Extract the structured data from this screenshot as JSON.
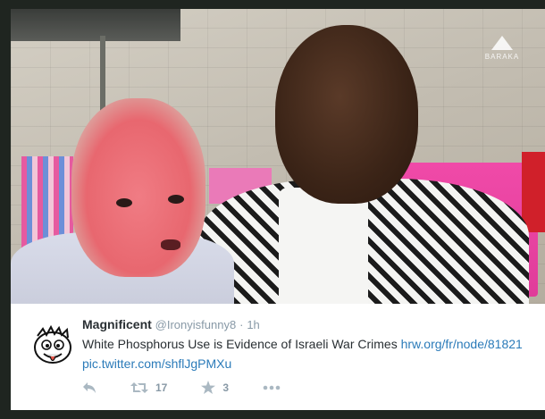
{
  "photo": {
    "watermark": "BARAKA"
  },
  "tweet": {
    "display_name": "Magnificent",
    "handle": "@Ironyisfunny8",
    "separator": "·",
    "timestamp": "1h",
    "text": "White Phosphorus Use is Evidence of Israeli War Crimes",
    "link1": "hrw.org/fr/node/81821",
    "link2": "pic.twitter.com/shflJgPMXu",
    "actions": {
      "reply_icon": "reply-icon",
      "retweet_icon": "retweet-icon",
      "retweet_count": "17",
      "favorite_icon": "star-icon",
      "favorite_count": "3",
      "more_icon": "more-icon"
    }
  },
  "colors": {
    "link": "#2b7bb9",
    "muted": "#8899a6",
    "text": "#292f33"
  }
}
